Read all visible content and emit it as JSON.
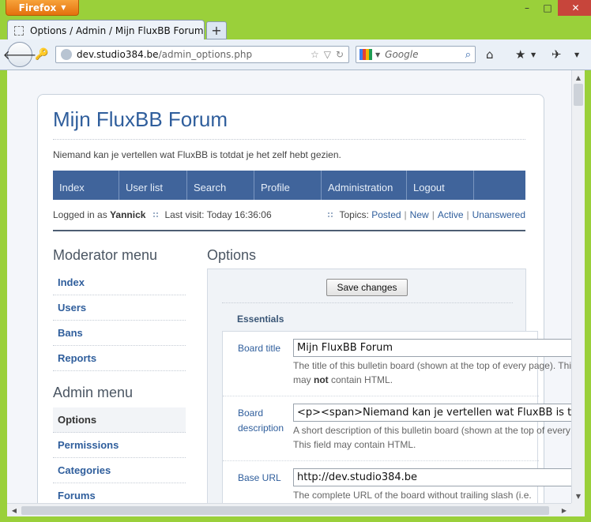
{
  "browser": {
    "menu_button": "Firefox",
    "tab_title": "Options / Admin / Mijn FluxBB Forum",
    "new_tab": "+",
    "url_host": "dev.studio384.be",
    "url_path": "/admin_options.php",
    "search_placeholder": "Google",
    "icons": {
      "back": "back-arrow-icon",
      "site_identity": "key-icon",
      "bookmark_star": "star-icon",
      "reload": "reload-icon",
      "search_engine": "google-icon",
      "search": "magnifier-icon",
      "home": "home-icon",
      "bookmarks": "bookmarks-icon",
      "addon": "addon-icon"
    },
    "window_controls": {
      "minimize": "–",
      "maximize": "□",
      "close": "✕"
    }
  },
  "forum": {
    "title": "Mijn FluxBB Forum",
    "description": "Niemand kan je vertellen wat FluxBB is totdat je het zelf hebt gezien.",
    "nav": [
      "Index",
      "User list",
      "Search",
      "Profile",
      "Administration",
      "Logout"
    ],
    "status": {
      "logged_in_prefix": "Logged in as",
      "username": "Yannick",
      "last_visit": "Last visit: Today 16:36:06",
      "topics_label": "Topics:",
      "topic_links": [
        "Posted",
        "New",
        "Active",
        "Unanswered"
      ]
    },
    "moderator_menu": {
      "heading": "Moderator menu",
      "items": [
        "Index",
        "Users",
        "Bans",
        "Reports"
      ]
    },
    "admin_menu": {
      "heading": "Admin menu",
      "items": [
        "Options",
        "Permissions",
        "Categories",
        "Forums"
      ],
      "active": "Options"
    },
    "main": {
      "heading": "Options",
      "save_button": "Save changes",
      "legend": "Essentials",
      "fields": [
        {
          "label": "Board title",
          "value": "Mijn FluxBB Forum",
          "help_pre": "The title of this bulletin board (shown at the top of every page). This field",
          "help_line2_pre": "may ",
          "help_line2_bold": "not",
          "help_line2_post": " contain HTML."
        },
        {
          "label": "Board description",
          "value": "<p><span>Niemand kan je vertellen wat FluxBB is totdat je het zelf hebt gezien.</span></p>",
          "help_pre": "A short description of this bulletin board (shown at the top of every page).",
          "help_line2": "This field may contain HTML."
        },
        {
          "label": "Base URL",
          "value": "http://dev.studio384.be",
          "help_pre": "The complete URL of the board without trailing slash (i.e."
        }
      ]
    }
  },
  "colors": {
    "frame": "#9ad03a",
    "firefox_button": "#e3710d",
    "close_button": "#c7453b",
    "nav_bar": "#40649b",
    "link": "#2f5e9c"
  }
}
